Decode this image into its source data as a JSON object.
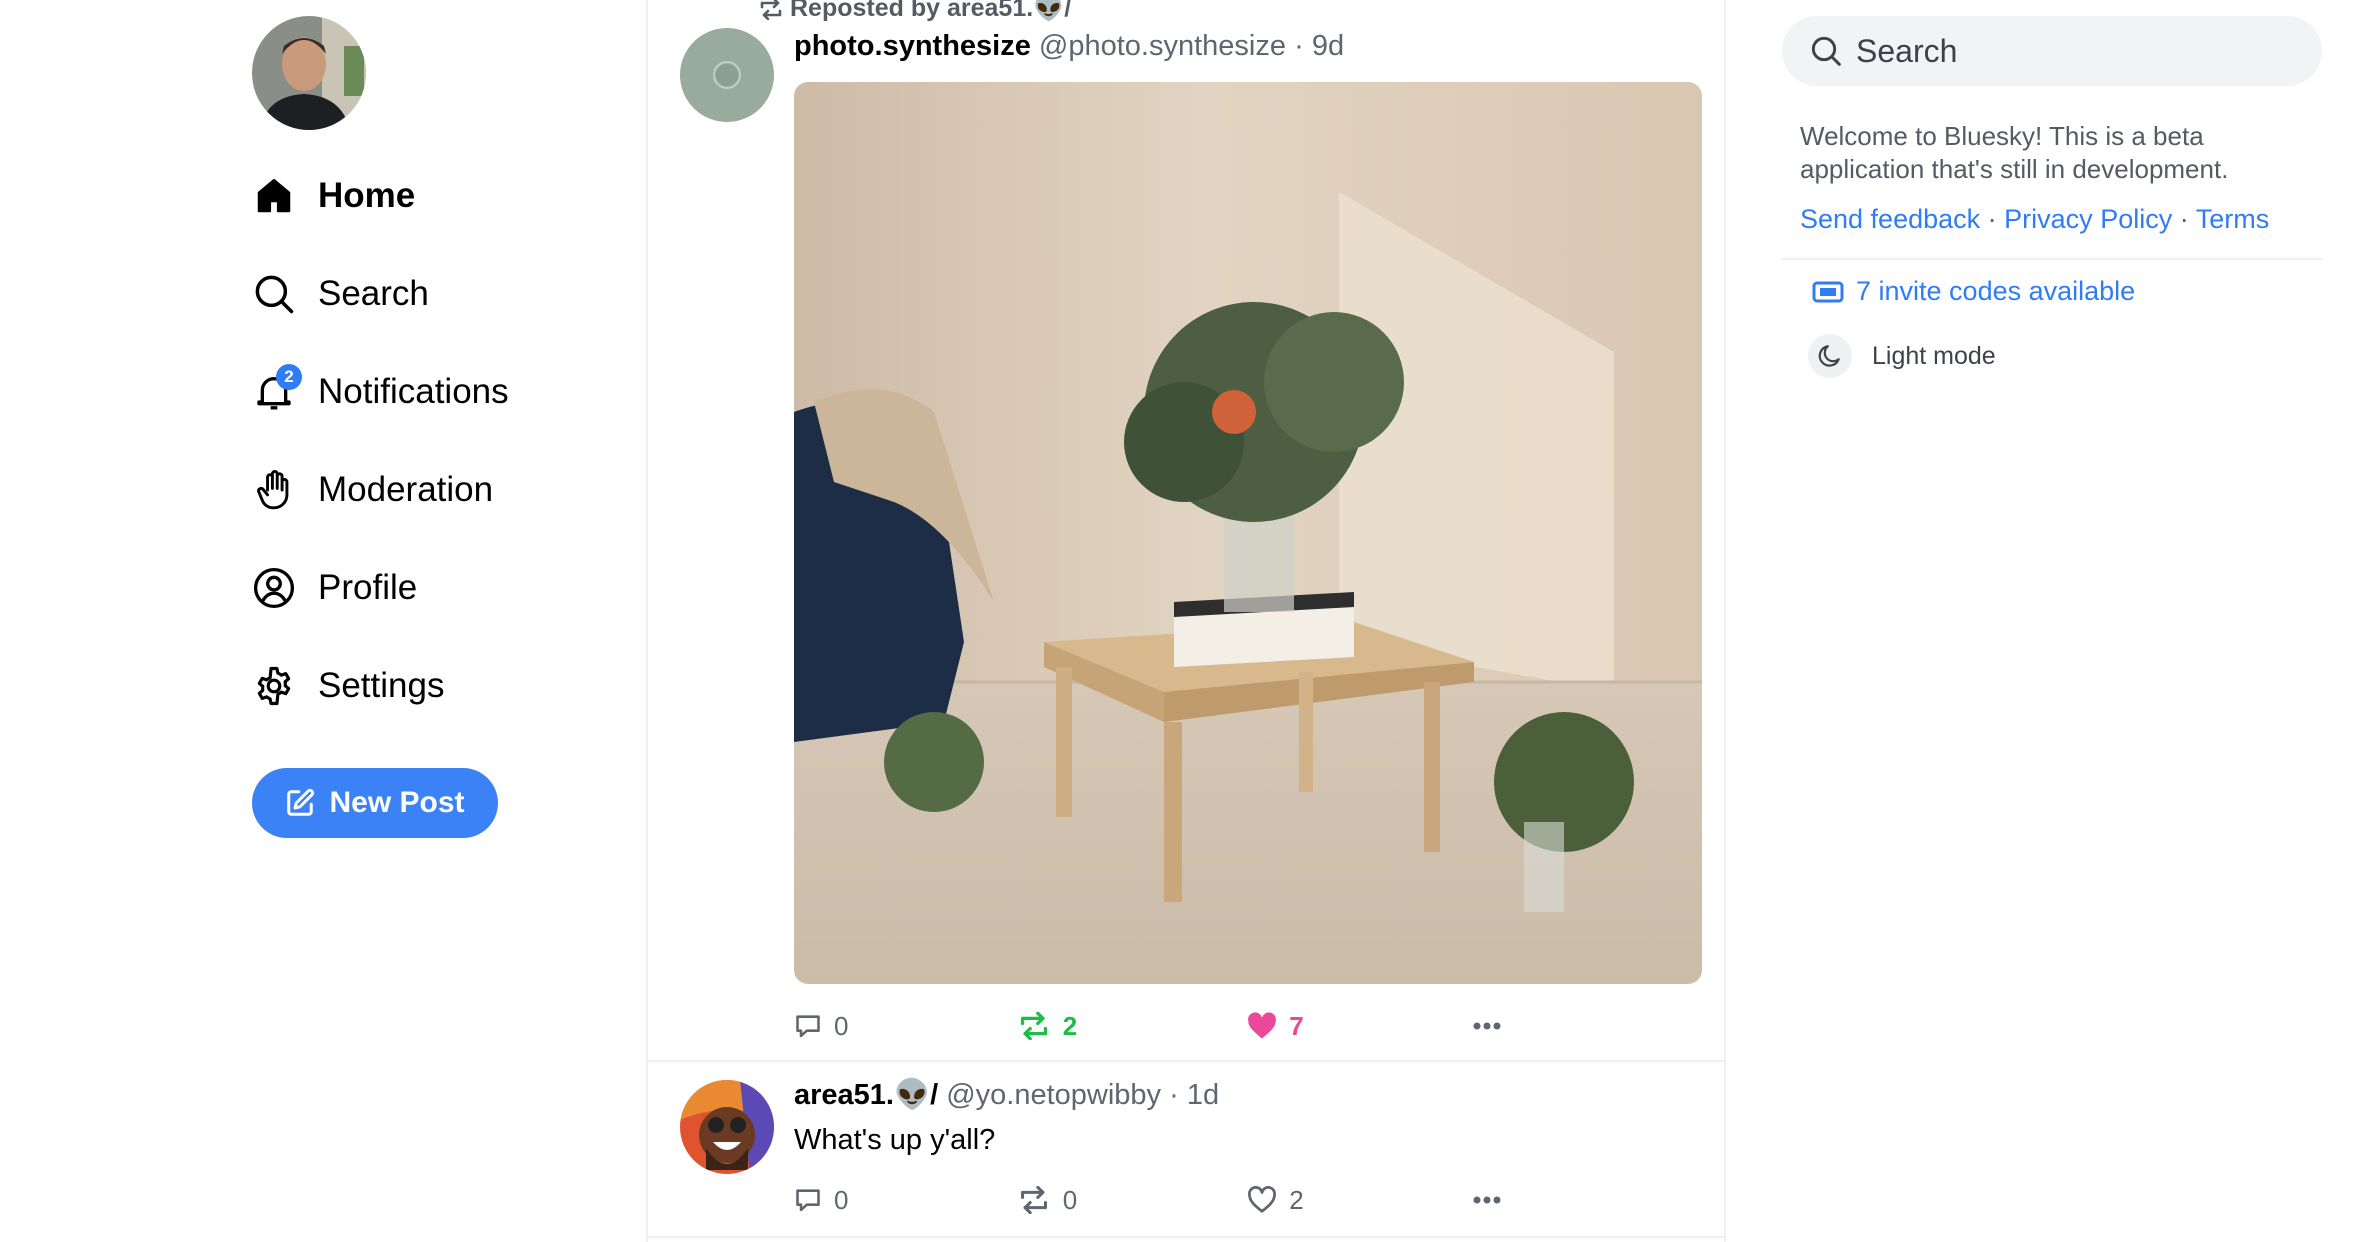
{
  "nav": {
    "items": [
      {
        "label": "Home",
        "icon": "home-icon"
      },
      {
        "label": "Search",
        "icon": "search-icon"
      },
      {
        "label": "Notifications",
        "icon": "bell-icon",
        "badge": "2"
      },
      {
        "label": "Moderation",
        "icon": "hand-icon"
      },
      {
        "label": "Profile",
        "icon": "user-circle-icon"
      },
      {
        "label": "Settings",
        "icon": "gear-icon"
      }
    ],
    "new_post_label": "New Post"
  },
  "feed": {
    "post1": {
      "reposted_by": "Reposted by area51.👽/",
      "author": "photo.synthesize",
      "handle": "@photo.synthesize",
      "age": "9d",
      "replies": "0",
      "reposts": "2",
      "likes": "7"
    },
    "post2": {
      "author": "area51.👽/",
      "handle": "@yo.netopwibby",
      "age": "1d",
      "text": "What's up y'all?",
      "replies": "0",
      "reposts": "0",
      "likes": "2"
    },
    "separator": "·"
  },
  "sidebar": {
    "search_placeholder": "Search",
    "welcome": "Welcome to Bluesky! This is a beta application that's still in development.",
    "links": {
      "feedback": "Send feedback",
      "privacy": "Privacy Policy",
      "terms": "Terms",
      "sep": "·"
    },
    "invites": "7 invite codes available",
    "theme": "Light mode"
  },
  "colors": {
    "accent": "#3b82f6",
    "repost_active": "#20bc4a",
    "like_active": "#ec4899"
  }
}
